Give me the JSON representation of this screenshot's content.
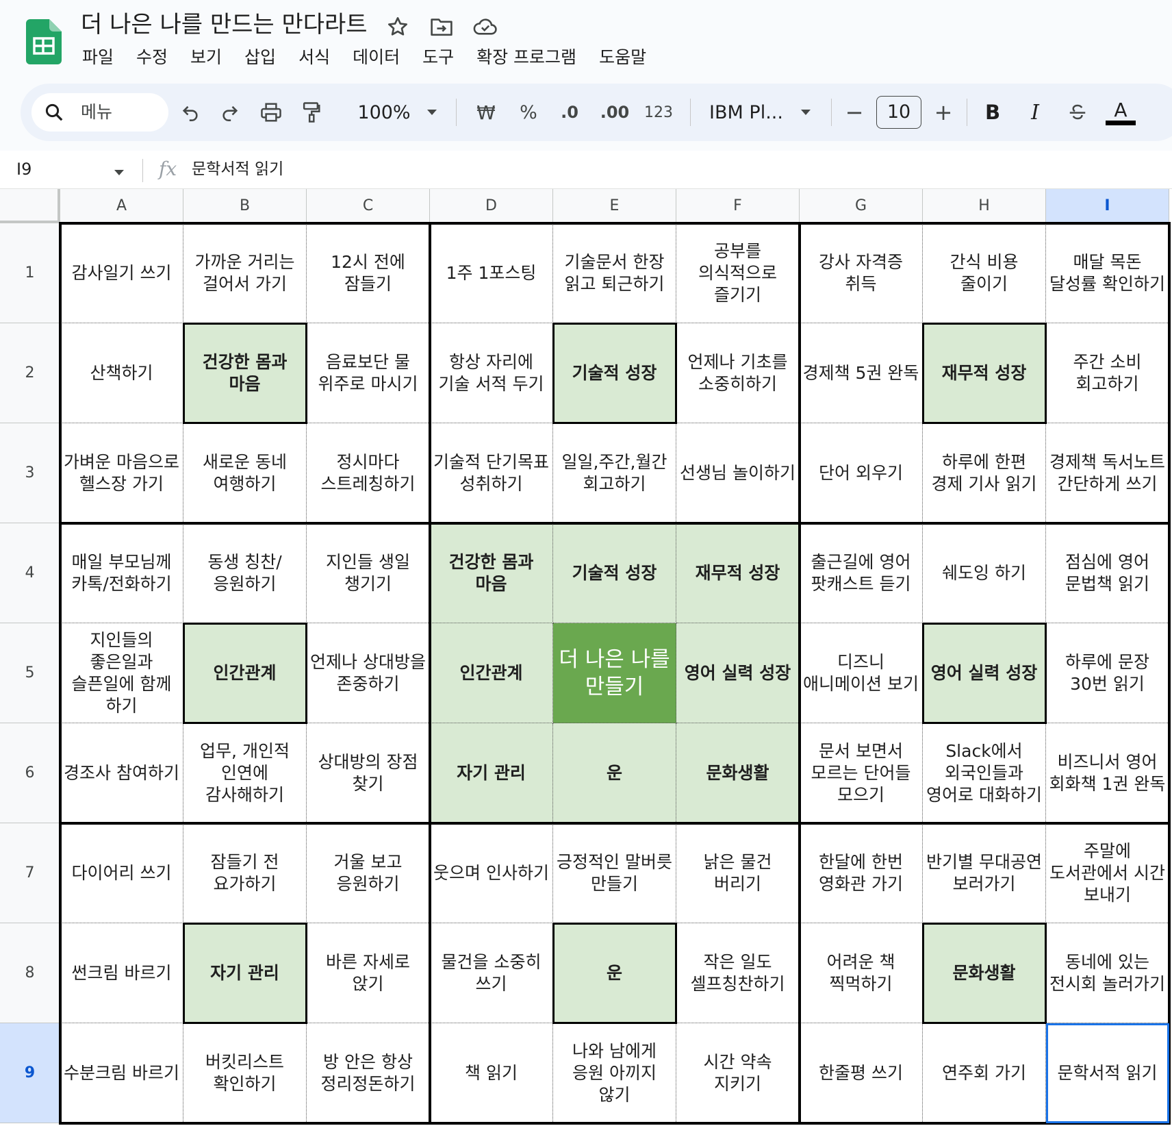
{
  "document": {
    "title": "더 나은 나를 만드는 만다라트"
  },
  "menu": [
    "파일",
    "수정",
    "보기",
    "삽입",
    "서식",
    "데이터",
    "도구",
    "확장 프로그램",
    "도움말"
  ],
  "toolbar": {
    "search_label": "메뉴",
    "zoom": "100%",
    "currency": "₩",
    "percent": "%",
    "decrease_decimal": ".0",
    "increase_decimal": ".00",
    "number_format": "123",
    "font": "IBM Pl...",
    "font_size": "10",
    "minus": "−",
    "plus": "+",
    "bold": "B",
    "italic": "I",
    "text_color": "A"
  },
  "formula_bar": {
    "cell_ref": "I9",
    "fx": "fx",
    "value": "문학서적 읽기"
  },
  "columns": [
    "A",
    "B",
    "C",
    "D",
    "E",
    "F",
    "G",
    "H",
    "I"
  ],
  "rows": [
    "1",
    "2",
    "3",
    "4",
    "5",
    "6",
    "7",
    "8",
    "9"
  ],
  "colors": {
    "subgoal_fill": "#d9ead3",
    "center_fill": "#6aa84f",
    "selection": "#1a73e8",
    "selected_header": "#d3e3fd"
  },
  "grid": [
    [
      "감사일기 쓰기",
      "가까운 거리는 걸어서 가기",
      "12시 전에 잠들기",
      "1주 1포스팅",
      "기술문서 한장 읽고 퇴근하기",
      "공부를 의식적으로 즐기기",
      "강사 자격증 취득",
      "간식 비용 줄이기",
      "매달 목돈 달성률 확인하기"
    ],
    [
      "산책하기",
      "건강한 몸과 마음",
      "음료보단 물 위주로 마시기",
      "항상 자리에 기술 서적 두기",
      "기술적 성장",
      "언제나 기초를 소중히하기",
      "경제책 5권 완독",
      "재무적 성장",
      "주간 소비 회고하기"
    ],
    [
      "가벼운 마음으로 헬스장 가기",
      "새로운 동네 여행하기",
      "정시마다 스트레칭하기",
      "기술적 단기목표 성취하기",
      "일일,주간,월간 회고하기",
      "선생님 놀이하기",
      "단어 외우기",
      "하루에 한편 경제 기사 읽기",
      "경제책 독서노트 간단하게 쓰기"
    ],
    [
      "매일 부모님께 카톡/전화하기",
      "동생 칭찬/응원하기",
      "지인들 생일 챙기기",
      "건강한 몸과 마음",
      "기술적 성장",
      "재무적 성장",
      "출근길에 영어 팟캐스트 듣기",
      "쉐도잉 하기",
      "점심에 영어 문법책 읽기"
    ],
    [
      "지인들의 좋은일과 슬픈일에 함께 하기",
      "인간관계",
      "언제나 상대방을 존중하기",
      "인간관계",
      "더 나은 나를 만들기",
      "영어 실력 성장",
      "디즈니 애니메이션 보기",
      "영어 실력 성장",
      "하루에 문장 30번 읽기"
    ],
    [
      "경조사 참여하기",
      "업무, 개인적 인연에 감사해하기",
      "상대방의 장점 찾기",
      "자기 관리",
      "운",
      "문화생활",
      "문서 보면서 모르는 단어들 모으기",
      "Slack에서 외국인들과 영어로 대화하기",
      "비즈니서 영어 회화책 1권 완독"
    ],
    [
      "다이어리 쓰기",
      "잠들기 전 요가하기",
      "거울 보고 응원하기",
      "웃으며 인사하기",
      "긍정적인 말버릇 만들기",
      "낡은 물건 버리기",
      "한달에 한번 영화관 가기",
      "반기별 무대공연 보러가기",
      "주말에 도서관에서 시간 보내기"
    ],
    [
      "썬크림 바르기",
      "자기 관리",
      "바른 자세로 앉기",
      "물건을 소중히 쓰기",
      "운",
      "작은 일도 셀프칭찬하기",
      "어려운 책 찍먹하기",
      "문화생활",
      "동네에 있는 전시회 놀러가기"
    ],
    [
      "수분크림 바르기",
      "버킷리스트 확인하기",
      "방 안은 항상 정리정돈하기",
      "책 읽기",
      "나와 남에게 응원 아끼지 않기",
      "시간 약속 지키기",
      "한줄평 쓰기",
      "연주회 가기",
      "문학서적 읽기"
    ]
  ]
}
